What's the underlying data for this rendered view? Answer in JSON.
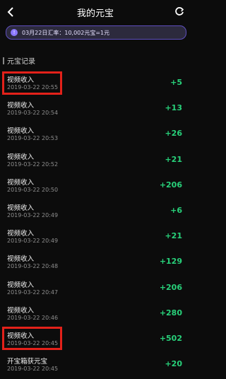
{
  "header": {
    "title": "我的元宝"
  },
  "banner": {
    "text": "03月22日汇率：10,002元宝=1元"
  },
  "section": {
    "title": "元宝记录"
  },
  "records": [
    {
      "name": "视频收入",
      "time": "2019-03-22 20:55",
      "amount": "+5"
    },
    {
      "name": "视频收入",
      "time": "2019-03-22 20:54",
      "amount": "+13"
    },
    {
      "name": "视频收入",
      "time": "2019-03-22 20:53",
      "amount": "+26"
    },
    {
      "name": "视频收入",
      "time": "2019-03-22 20:52",
      "amount": "+21"
    },
    {
      "name": "视频收入",
      "time": "2019-03-22 20:50",
      "amount": "+206"
    },
    {
      "name": "视频收入",
      "time": "2019-03-22 20:49",
      "amount": "+6"
    },
    {
      "name": "视频收入",
      "time": "2019-03-22 20:49",
      "amount": "+21"
    },
    {
      "name": "视频收入",
      "time": "2019-03-22 20:48",
      "amount": "+129"
    },
    {
      "name": "视频收入",
      "time": "2019-03-22 20:47",
      "amount": "+206"
    },
    {
      "name": "视频收入",
      "time": "2019-03-22 20:46",
      "amount": "+280"
    },
    {
      "name": "视频收入",
      "time": "2019-03-22 20:45",
      "amount": "+502"
    },
    {
      "name": "开宝箱获元宝",
      "time": "2019-03-22 20:45",
      "amount": "+20"
    }
  ],
  "colors": {
    "accent": "#28d17a",
    "highlight": "#e3211a",
    "banner_border": "#5f4fbf"
  },
  "icons": {
    "back": "back-arrow-icon",
    "refresh": "refresh-icon",
    "banner": "info-icon"
  }
}
